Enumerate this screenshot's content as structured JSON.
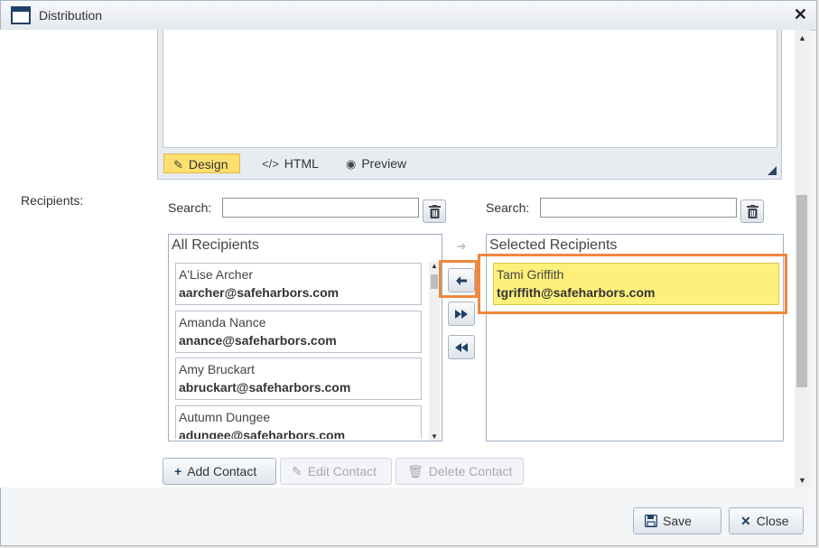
{
  "window": {
    "title": "Distribution",
    "close_glyph": "✕"
  },
  "editor": {
    "tabs": [
      {
        "label": "Design",
        "icon": "pencil-icon",
        "glyph": "✎"
      },
      {
        "label": "HTML",
        "icon": "code-icon",
        "glyph": "</>"
      },
      {
        "label": "Preview",
        "icon": "eye-icon",
        "glyph": "👁"
      }
    ]
  },
  "recipients": {
    "label": "Recipients:",
    "search_label_left": "Search:",
    "search_label_right": "Search:",
    "search_left_value": "",
    "search_right_value": "",
    "all_header": "All Recipients",
    "selected_header": "Selected Recipients",
    "all": [
      {
        "name": "A'Lise Archer",
        "email": "aarcher@safeharbors.com"
      },
      {
        "name": "Amanda Nance",
        "email": "anance@safeharbors.com"
      },
      {
        "name": "Amy Bruckart",
        "email": "abruckart@safeharbors.com"
      },
      {
        "name": "Autumn Dungee",
        "email": "adungee@safeharbors.com"
      }
    ],
    "selected": [
      {
        "name": "Tami Griffith",
        "email": "tgriffith@safeharbors.com"
      }
    ],
    "move_buttons": {
      "add_one": "➔",
      "remove_one": "🡐",
      "add_all": "▶▶",
      "remove_all": "◀◀"
    }
  },
  "contact_actions": {
    "add": "Add Contact",
    "edit": "Edit Contact",
    "delete": "Delete Contact"
  },
  "footer": {
    "save": "Save",
    "close": "Close"
  },
  "colors": {
    "highlight": "#f0883e",
    "selected_bg": "#fdf07b",
    "active_tab": "#fde070"
  }
}
